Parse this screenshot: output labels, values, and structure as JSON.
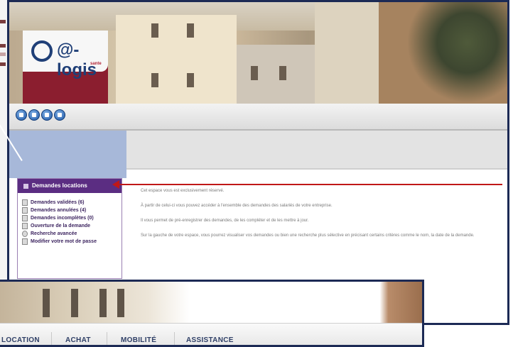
{
  "brand": {
    "logo_text": "@-logis",
    "logo_sub": "sante",
    "brand_color": "#8b1e2f",
    "logo_blue": "#1f3f77"
  },
  "toolbar": {
    "buttons": [
      {
        "icon": "blue-round-button-icon"
      },
      {
        "icon": "blue-round-button-icon"
      },
      {
        "icon": "blue-round-button-icon"
      },
      {
        "icon": "blue-round-button-icon"
      }
    ]
  },
  "sidebar": {
    "title": "Demandes locations",
    "header_color": "#5b2d82",
    "items": [
      {
        "label": "Demandes validées (6)",
        "icon": "document-icon"
      },
      {
        "label": "Demandes annulées (4)",
        "icon": "document-icon"
      },
      {
        "label": "Demandes incomplètes (0)",
        "icon": "document-icon"
      },
      {
        "label": "Ouverture de la demande",
        "icon": "document-edit-icon"
      },
      {
        "label": "Recherche avancée",
        "icon": "magnifier-icon"
      },
      {
        "label": "Modifier votre mot de passe",
        "icon": "document-edit-icon"
      }
    ]
  },
  "main": {
    "paragraphs": [
      "Cet espace vous est exclusivement réservé.",
      "À partir de celui-ci vous pouvez accéder à l'ensemble des demandes des salariés de votre entreprise.",
      "Il vous permet de pré-enregistrer des demandes, de les compléter et de les mettre à jour.",
      "Sur la gauche de votre espace, vous pourrez visualiser vos demandes ou bien une recherche plus sélective en précisant certains critères comme le nom, la date de la demande."
    ]
  },
  "annotation": {
    "arrow_color": "#c01818",
    "frame_color": "#1c2a55"
  },
  "bottom_nav": {
    "items": [
      "LOCATION",
      "ACHAT",
      "MOBILITÉ",
      "ASSISTANCE"
    ]
  }
}
